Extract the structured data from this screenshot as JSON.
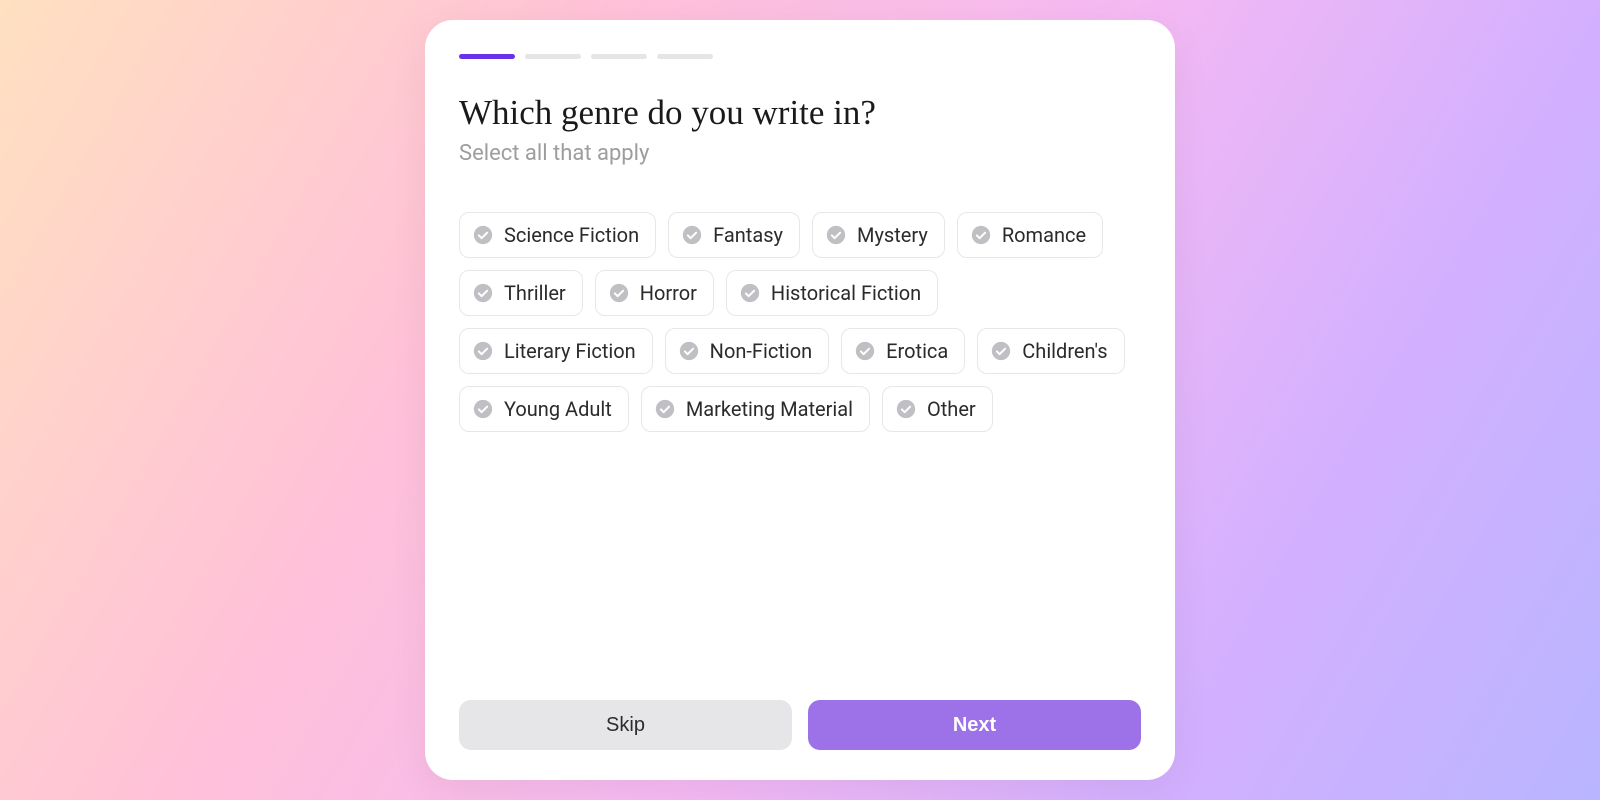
{
  "progress": {
    "total": 4,
    "current": 1
  },
  "heading": "Which genre do you write in?",
  "subheading": "Select all that apply",
  "genres": [
    "Science Fiction",
    "Fantasy",
    "Mystery",
    "Romance",
    "Thriller",
    "Horror",
    "Historical Fiction",
    "Literary Fiction",
    "Non-Fiction",
    "Erotica",
    "Children's",
    "Young Adult",
    "Marketing Material",
    "Other"
  ],
  "buttons": {
    "skip": "Skip",
    "next": "Next"
  },
  "colors": {
    "progress_active": "#6a32e6",
    "progress_inactive": "#e5e5e7",
    "next_button": "#9d72e8",
    "skip_button": "#e6e6e8",
    "chip_border": "#e7e7ea",
    "check_icon": "#c0c0c4"
  }
}
